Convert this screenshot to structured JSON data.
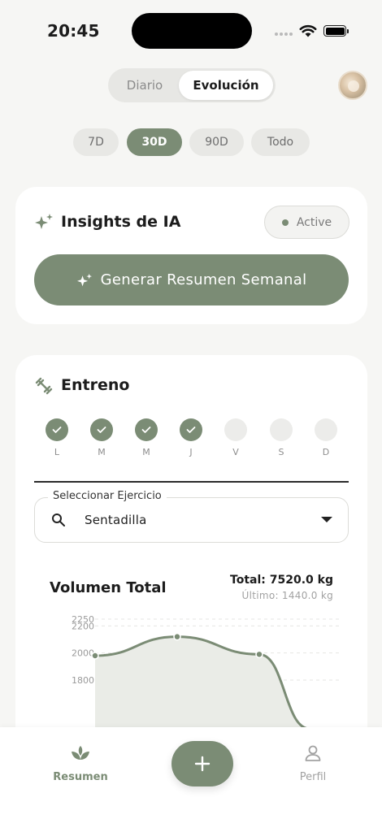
{
  "status": {
    "time": "20:45"
  },
  "segment": {
    "tabs": [
      "Diario",
      "Evolución"
    ],
    "active": "Evolución"
  },
  "ranges": [
    "7D",
    "30D",
    "90D",
    "Todo"
  ],
  "active_range": "30D",
  "ia_card": {
    "title": "Insights de IA",
    "status": "Active",
    "button": "Generar Resumen Semanal"
  },
  "entreno": {
    "title": "Entreno",
    "days": [
      {
        "label": "L",
        "done": true
      },
      {
        "label": "M",
        "done": true
      },
      {
        "label": "M",
        "done": true
      },
      {
        "label": "J",
        "done": true
      },
      {
        "label": "V",
        "done": false
      },
      {
        "label": "S",
        "done": false
      },
      {
        "label": "D",
        "done": false
      }
    ],
    "select_label": "Seleccionar Ejercicio",
    "select_value": "Sentadilla"
  },
  "chart": {
    "title": "Volumen Total",
    "total": "Total: 7520.0 kg",
    "last": "Último: 1440.0 kg"
  },
  "chart_data": {
    "type": "area",
    "x": [
      0,
      1,
      2,
      3
    ],
    "values": [
      1980,
      2120,
      1990,
      1440
    ],
    "ylim": [
      1440,
      2250
    ],
    "yticks": [
      2250,
      2200,
      2000,
      1800
    ],
    "grid": true
  },
  "nav": {
    "home": "Resumen",
    "profile": "Perfil",
    "fab": "+"
  },
  "colors": {
    "accent": "#7b8c75",
    "background": "#f6f6f4"
  }
}
